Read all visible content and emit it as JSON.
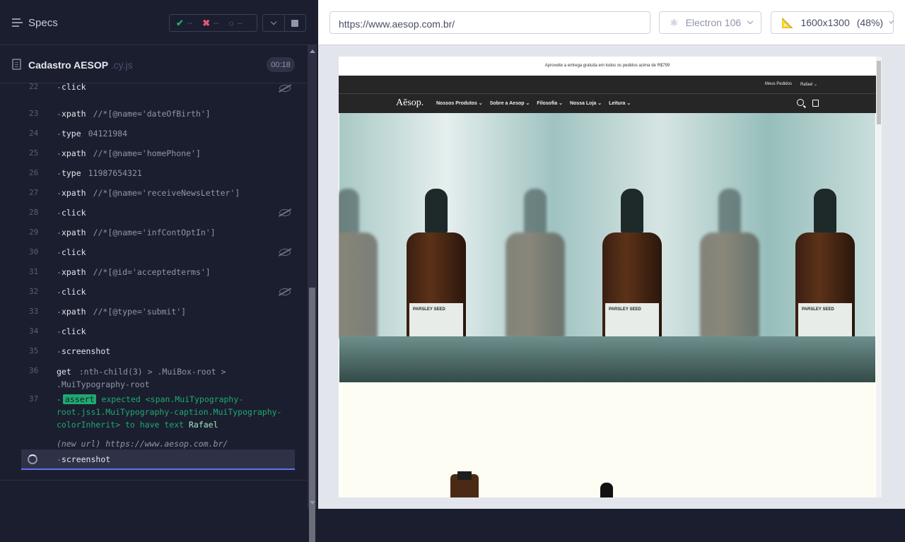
{
  "reporter": {
    "specs_label": "Specs",
    "stats": {
      "passed": "--",
      "failed": "--",
      "pending": "--"
    },
    "file": {
      "name": "Cadastro AESOP",
      "ext": ".cy.js",
      "duration": "00:18"
    },
    "commands": [
      {
        "num": "22",
        "name": "click",
        "arg": "",
        "hidden": true
      },
      {
        "num": "23",
        "name": "xpath",
        "arg": "//*[@name='dateOfBirth']",
        "hidden": false
      },
      {
        "num": "24",
        "name": "type",
        "arg": "04121984",
        "hidden": false
      },
      {
        "num": "25",
        "name": "xpath",
        "arg": "//*[@name='homePhone']",
        "hidden": false
      },
      {
        "num": "26",
        "name": "type",
        "arg": "11987654321",
        "hidden": false
      },
      {
        "num": "27",
        "name": "xpath",
        "arg": "//*[@name='receiveNewsLetter']",
        "hidden": false
      },
      {
        "num": "28",
        "name": "click",
        "arg": "",
        "hidden": true
      },
      {
        "num": "29",
        "name": "xpath",
        "arg": "//*[@name='infContOptIn']",
        "hidden": false
      },
      {
        "num": "30",
        "name": "click",
        "arg": "",
        "hidden": true
      },
      {
        "num": "31",
        "name": "xpath",
        "arg": "//*[@id='acceptedterms']",
        "hidden": false
      },
      {
        "num": "32",
        "name": "click",
        "arg": "",
        "hidden": true
      },
      {
        "num": "33",
        "name": "xpath",
        "arg": "//*[@type='submit']",
        "hidden": false
      },
      {
        "num": "34",
        "name": "click",
        "arg": "",
        "hidden": false
      },
      {
        "num": "35",
        "name": "screenshot",
        "arg": "",
        "hidden": false
      }
    ],
    "get_cmd": {
      "num": "36",
      "name": "get",
      "arg1": ":nth-child(3) > .MuiBox-root >",
      "arg2": ".MuiTypography-root"
    },
    "assert_cmd": {
      "num": "37",
      "badge": "assert",
      "line1": "expected <span.MuiTypography-",
      "line2": "root.jss1.MuiTypography-caption.MuiTypography-",
      "line3_a": "colorInherit>",
      "line3_b": "to have text",
      "line3_c": "Rafael"
    },
    "new_url": {
      "label": "(new url)",
      "url": "https://www.aesop.com.br/"
    },
    "active_cmd": {
      "name": "screenshot"
    }
  },
  "runner": {
    "url": "https://www.aesop.com.br/",
    "browser": "Electron 106",
    "viewport": "1600x1300",
    "zoom": "(48%)"
  },
  "site": {
    "announcement": "Aproveite a entrega gratuita em todos os pedidos acima de R$799",
    "top_links": [
      "Meus Pedidos",
      "Rafael ⌄"
    ],
    "logo": "Aēsop.",
    "menu": [
      "Nossos Produtos",
      "Sobre a Aesop",
      "Filosofia",
      "Nossa Loja",
      "Leitura"
    ],
    "bottle_label": "PARSLEY SEED"
  }
}
